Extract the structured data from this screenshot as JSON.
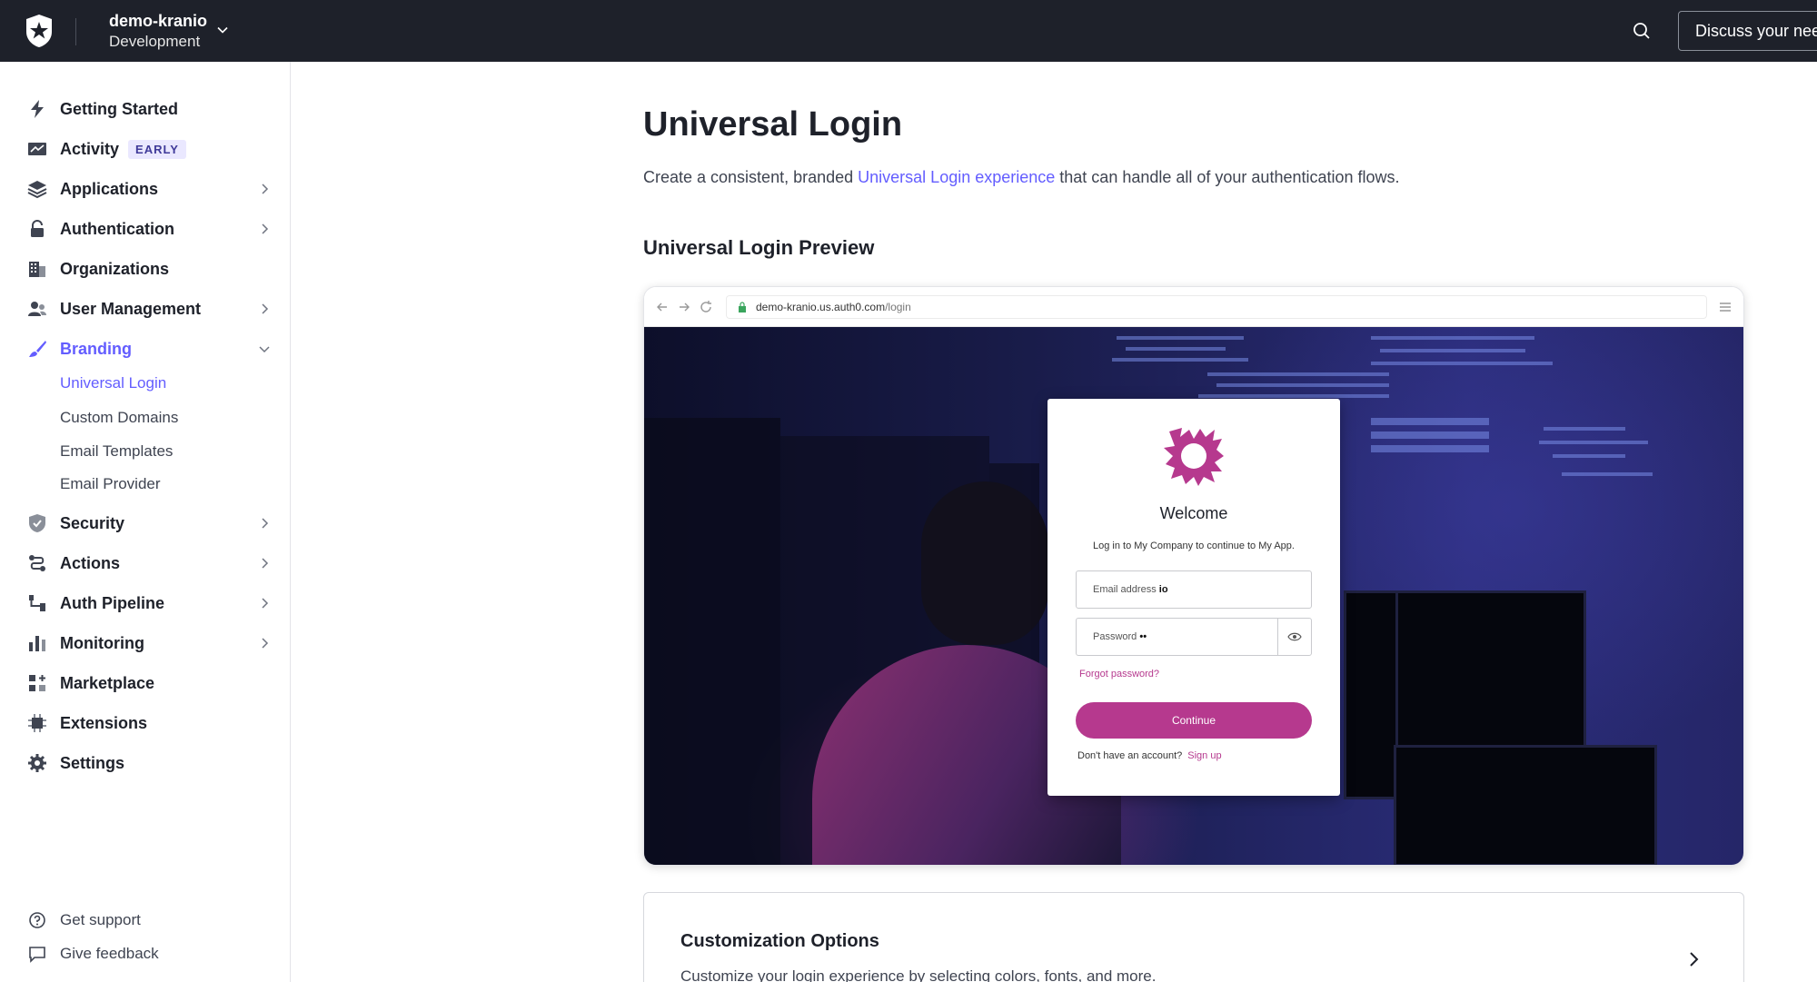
{
  "topbar": {
    "tenant_name": "demo-kranio",
    "tenant_env": "Development",
    "discuss_label": "Discuss your needs"
  },
  "sidebar": {
    "items": [
      {
        "label": "Getting Started"
      },
      {
        "label": "Activity",
        "badge": "EARLY"
      },
      {
        "label": "Applications"
      },
      {
        "label": "Authentication"
      },
      {
        "label": "Organizations"
      },
      {
        "label": "User Management"
      },
      {
        "label": "Branding"
      },
      {
        "label": "Security"
      },
      {
        "label": "Actions"
      },
      {
        "label": "Auth Pipeline"
      },
      {
        "label": "Monitoring"
      },
      {
        "label": "Marketplace"
      },
      {
        "label": "Extensions"
      },
      {
        "label": "Settings"
      }
    ],
    "branding_sub": [
      "Universal Login",
      "Custom Domains",
      "Email Templates",
      "Email Provider"
    ],
    "footer": {
      "support": "Get support",
      "feedback": "Give feedback"
    }
  },
  "main": {
    "title": "Universal Login",
    "desc_pre": "Create a consistent, branded ",
    "desc_link": "Universal Login experience",
    "desc_post": " that can handle all of your authentication flows.",
    "preview_title": "Universal Login Preview",
    "preview": {
      "url_host": "demo-kranio.us.auth0.com",
      "url_path": "/login",
      "welcome": "Welcome",
      "subtitle": "Log in to My Company to continue to My App.",
      "email_placeholder": "Email address",
      "email_value": "io",
      "password_placeholder": "Password",
      "password_value": "••",
      "forgot": "Forgot password?",
      "continue": "Continue",
      "no_account": "Don't have an account?",
      "signup": "Sign up",
      "brand_color": "#b6398e"
    },
    "customization": {
      "title": "Customization Options",
      "desc": "Customize your login experience by selecting colors, fonts, and more."
    }
  },
  "colors": {
    "accent": "#635dff",
    "topbar": "#1e212a"
  }
}
